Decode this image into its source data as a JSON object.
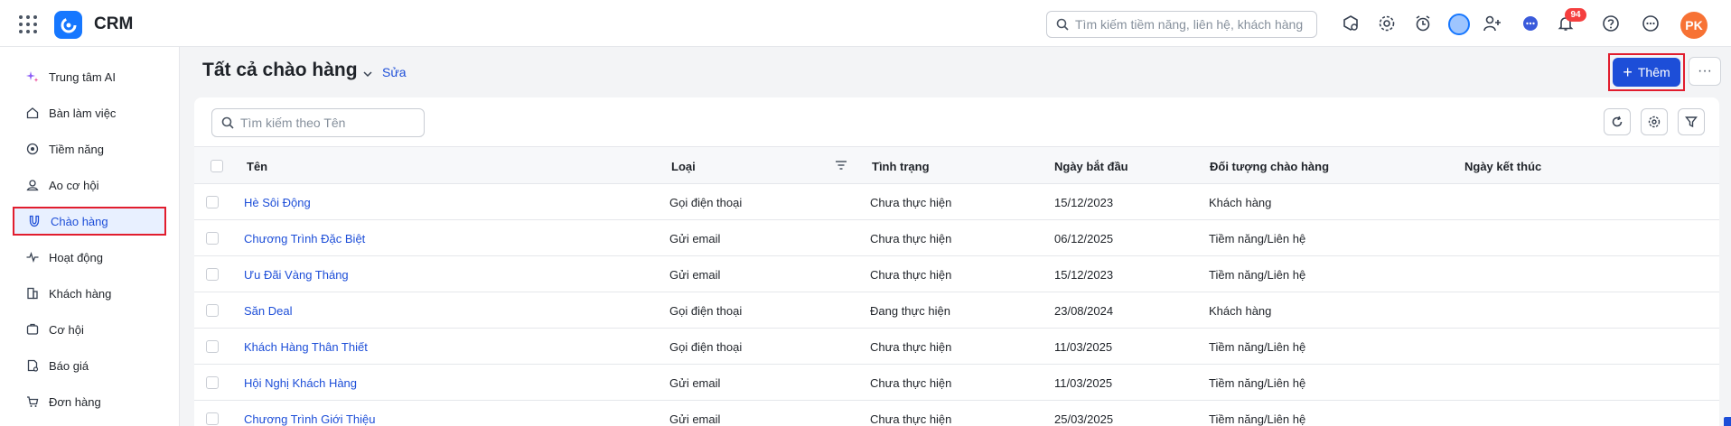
{
  "app": {
    "name": "CRM"
  },
  "topbar": {
    "search_placeholder": "Tìm kiếm tiềm năng, liên hệ, khách hàng",
    "notification_count": "94",
    "user_initials": "PK"
  },
  "sidebar": {
    "items": [
      {
        "label": "Trung tâm AI",
        "icon": "sparkle-icon"
      },
      {
        "label": "Bàn làm việc",
        "icon": "home-icon"
      },
      {
        "label": "Tiềm năng",
        "icon": "target-icon"
      },
      {
        "label": "Ao cơ hội",
        "icon": "pond-icon"
      },
      {
        "label": "Chào hàng",
        "icon": "magnet-icon",
        "active": true
      },
      {
        "label": "Hoạt động",
        "icon": "activity-icon"
      },
      {
        "label": "Khách hàng",
        "icon": "building-icon"
      },
      {
        "label": "Cơ hội",
        "icon": "folder-icon"
      },
      {
        "label": "Báo giá",
        "icon": "quote-icon"
      },
      {
        "label": "Đơn hàng",
        "icon": "cart-icon"
      }
    ]
  },
  "header": {
    "title": "Tất cả chào hàng",
    "edit_label": "Sửa",
    "add_label": "Thêm",
    "more_label": "···"
  },
  "list": {
    "search_placeholder": "Tìm kiếm theo Tên",
    "columns": [
      "Tên",
      "Loại",
      "Tình trạng",
      "Ngày bắt đầu",
      "Đối tượng chào hàng",
      "Ngày kết thúc"
    ],
    "rows": [
      {
        "name": "Hè Sôi Động",
        "type": "Gọi điện thoại",
        "status": "Chưa thực hiện",
        "start": "15/12/2023",
        "target": "Khách hàng",
        "end": ""
      },
      {
        "name": "Chương Trình Đặc Biệt",
        "type": "Gửi email",
        "status": "Chưa thực hiện",
        "start": "06/12/2025",
        "target": "Tiềm năng/Liên hệ",
        "end": ""
      },
      {
        "name": "Ưu Đãi Vàng Tháng",
        "type": "Gửi email",
        "status": "Chưa thực hiện",
        "start": "15/12/2023",
        "target": "Tiềm năng/Liên hệ",
        "end": ""
      },
      {
        "name": "Săn Deal",
        "type": "Gọi điện thoại",
        "status": "Đang thực hiện",
        "start": "23/08/2024",
        "target": "Khách hàng",
        "end": ""
      },
      {
        "name": "Khách Hàng Thân Thiết",
        "type": "Gọi điện thoại",
        "status": "Chưa thực hiện",
        "start": "11/03/2025",
        "target": "Tiềm năng/Liên hệ",
        "end": ""
      },
      {
        "name": "Hội Nghị Khách Hàng",
        "type": "Gửi email",
        "status": "Chưa thực hiện",
        "start": "11/03/2025",
        "target": "Tiềm năng/Liên hệ",
        "end": ""
      },
      {
        "name": "Chương Trình Giới Thiệu",
        "type": "Gửi email",
        "status": "Chưa thực hiện",
        "start": "25/03/2025",
        "target": "Tiềm năng/Liên hệ",
        "end": ""
      }
    ]
  },
  "colors": {
    "accent": "#1d4ed8",
    "highlight": "#e11d2e",
    "badge": "#f53f3f",
    "avatar": "#f77234"
  }
}
